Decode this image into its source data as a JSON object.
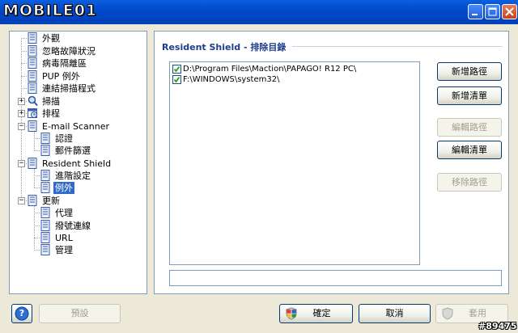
{
  "app": {
    "logo_text": "MOBILE01"
  },
  "tree": {
    "items": [
      {
        "label": "外觀"
      },
      {
        "label": "忽略故障狀況"
      },
      {
        "label": "病毒隔離區"
      },
      {
        "label": "PUP 例外"
      },
      {
        "label": "連結掃描程式"
      },
      {
        "label": "掃描"
      },
      {
        "label": "排程"
      },
      {
        "label": "E-mail Scanner"
      },
      {
        "label": "認證"
      },
      {
        "label": "郵件篩選"
      },
      {
        "label": "Resident Shield"
      },
      {
        "label": "進階設定"
      },
      {
        "label": "例外"
      },
      {
        "label": "更新"
      },
      {
        "label": "代理"
      },
      {
        "label": "撥號連線"
      },
      {
        "label": "URL"
      },
      {
        "label": "管理"
      }
    ],
    "selected": "例外"
  },
  "panel": {
    "title": "Resident Shield - 排除目錄",
    "paths": [
      {
        "checked": true,
        "path": "D:\\Program Files\\Maction\\PAPAGO! R12 PC\\"
      },
      {
        "checked": true,
        "path": "F:\\WINDOWS\\system32\\"
      }
    ],
    "buttons": {
      "add_path": "新增路徑",
      "add_list": "新增清單",
      "edit_path": "編輯路徑",
      "edit_list": "編輯清單",
      "remove_path": "移除路徑"
    },
    "status_text": ""
  },
  "footer": {
    "help_label": "?",
    "default_label": "預設",
    "ok_label": "確定",
    "cancel_label": "取消",
    "apply_label": "套用"
  },
  "watermark": "#89475"
}
